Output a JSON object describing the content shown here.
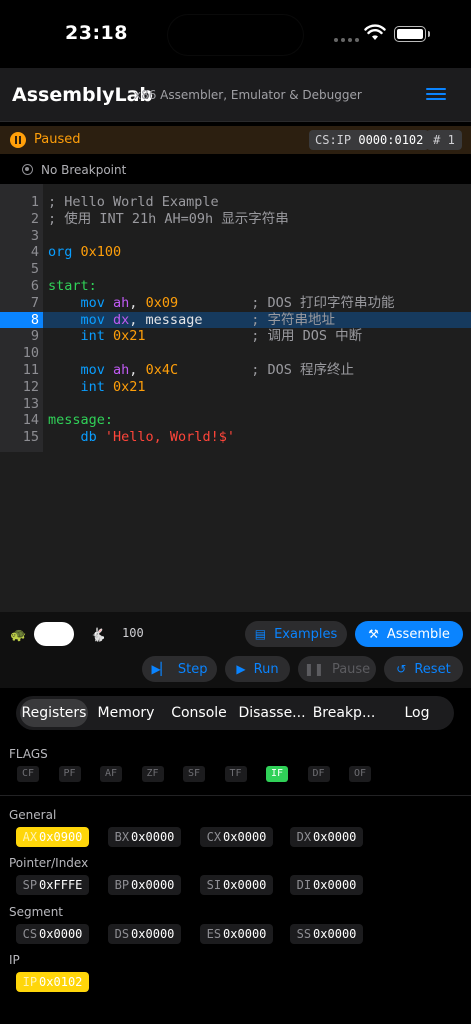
{
  "status_bar": {
    "time": "23:18"
  },
  "header": {
    "title": "AssemblyLab",
    "subtitle": "x86 Assembler, Emulator & Debugger"
  },
  "run_state": {
    "status": "Paused",
    "csip_label": "CS:IP",
    "csip_value": "0000:0102",
    "count": "# 1",
    "breakpoint_text": "No Breakpoint"
  },
  "editor": {
    "current_line": 8,
    "lines": [
      {
        "n": "1",
        "tokens": [
          [
            "c-com",
            "; Hello World Example"
          ]
        ]
      },
      {
        "n": "2",
        "tokens": [
          [
            "c-com",
            "; 使用 INT 21h AH=09h 显示字符串"
          ]
        ]
      },
      {
        "n": "3",
        "tokens": []
      },
      {
        "n": "4",
        "tokens": [
          [
            "c-kw",
            "org "
          ],
          [
            "c-num",
            "0x100"
          ]
        ]
      },
      {
        "n": "5",
        "tokens": []
      },
      {
        "n": "6",
        "tokens": [
          [
            "c-lbl",
            "start:"
          ]
        ]
      },
      {
        "n": "7",
        "tokens": [
          [
            "c-kw",
            "    mov "
          ],
          [
            "c-reg",
            "ah"
          ],
          [
            "c-txt",
            ", "
          ],
          [
            "c-num",
            "0x09"
          ],
          [
            "c-com",
            "         ; DOS 打印字符串功能"
          ]
        ]
      },
      {
        "n": "8",
        "tokens": [
          [
            "c-kw",
            "    mov "
          ],
          [
            "c-reg",
            "dx"
          ],
          [
            "c-txt",
            ", message"
          ],
          [
            "c-com",
            "      ; 字符串地址"
          ]
        ]
      },
      {
        "n": "9",
        "tokens": [
          [
            "c-kw",
            "    int "
          ],
          [
            "c-num",
            "0x21"
          ],
          [
            "c-com",
            "             ; 调用 DOS 中断"
          ]
        ]
      },
      {
        "n": "10",
        "tokens": []
      },
      {
        "n": "11",
        "tokens": [
          [
            "c-kw",
            "    mov "
          ],
          [
            "c-reg",
            "ah"
          ],
          [
            "c-txt",
            ", "
          ],
          [
            "c-num",
            "0x4C"
          ],
          [
            "c-com",
            "         ; DOS 程序终止"
          ]
        ]
      },
      {
        "n": "12",
        "tokens": [
          [
            "c-kw",
            "    int "
          ],
          [
            "c-num",
            "0x21"
          ]
        ]
      },
      {
        "n": "13",
        "tokens": []
      },
      {
        "n": "14",
        "tokens": [
          [
            "c-lbl",
            "message:"
          ]
        ]
      },
      {
        "n": "15",
        "tokens": [
          [
            "c-kw",
            "    db "
          ],
          [
            "c-str",
            "'Hello, World!$'"
          ]
        ]
      }
    ]
  },
  "controls": {
    "speed_value": "100",
    "examples_label": "Examples",
    "assemble_label": "Assemble",
    "step_label": "Step",
    "run_label": "Run",
    "pause_label": "Pause",
    "reset_label": "Reset"
  },
  "tabs": [
    "Registers",
    "Memory",
    "Console",
    "Disasse...",
    "Breakp...",
    "Log"
  ],
  "active_tab": 0,
  "registers": {
    "flags_label": "FLAGS",
    "flags": [
      {
        "name": "CF",
        "on": false
      },
      {
        "name": "PF",
        "on": false
      },
      {
        "name": "AF",
        "on": false
      },
      {
        "name": "ZF",
        "on": false
      },
      {
        "name": "SF",
        "on": false
      },
      {
        "name": "TF",
        "on": false
      },
      {
        "name": "IF",
        "on": true
      },
      {
        "name": "DF",
        "on": false
      },
      {
        "name": "OF",
        "on": false
      }
    ],
    "groups": [
      {
        "label": "General",
        "regs": [
          {
            "name": "AX",
            "value": "0x0900",
            "changed": true
          },
          {
            "name": "BX",
            "value": "0x0000",
            "changed": false
          },
          {
            "name": "CX",
            "value": "0x0000",
            "changed": false
          },
          {
            "name": "DX",
            "value": "0x0000",
            "changed": false
          }
        ]
      },
      {
        "label": "Pointer/Index",
        "regs": [
          {
            "name": "SP",
            "value": "0xFFFE",
            "changed": false
          },
          {
            "name": "BP",
            "value": "0x0000",
            "changed": false
          },
          {
            "name": "SI",
            "value": "0x0000",
            "changed": false
          },
          {
            "name": "DI",
            "value": "0x0000",
            "changed": false
          }
        ]
      },
      {
        "label": "Segment",
        "regs": [
          {
            "name": "CS",
            "value": "0x0000",
            "changed": false
          },
          {
            "name": "DS",
            "value": "0x0000",
            "changed": false
          },
          {
            "name": "ES",
            "value": "0x0000",
            "changed": false
          },
          {
            "name": "SS",
            "value": "0x0000",
            "changed": false
          }
        ]
      },
      {
        "label": "IP",
        "regs": [
          {
            "name": "IP",
            "value": "0x0102",
            "changed": true
          }
        ]
      }
    ]
  },
  "colors": {
    "accent": "#0a84ff",
    "paused": "#ff9f0a",
    "flag_on": "#30d158",
    "changed_reg": "#ffd60a"
  }
}
